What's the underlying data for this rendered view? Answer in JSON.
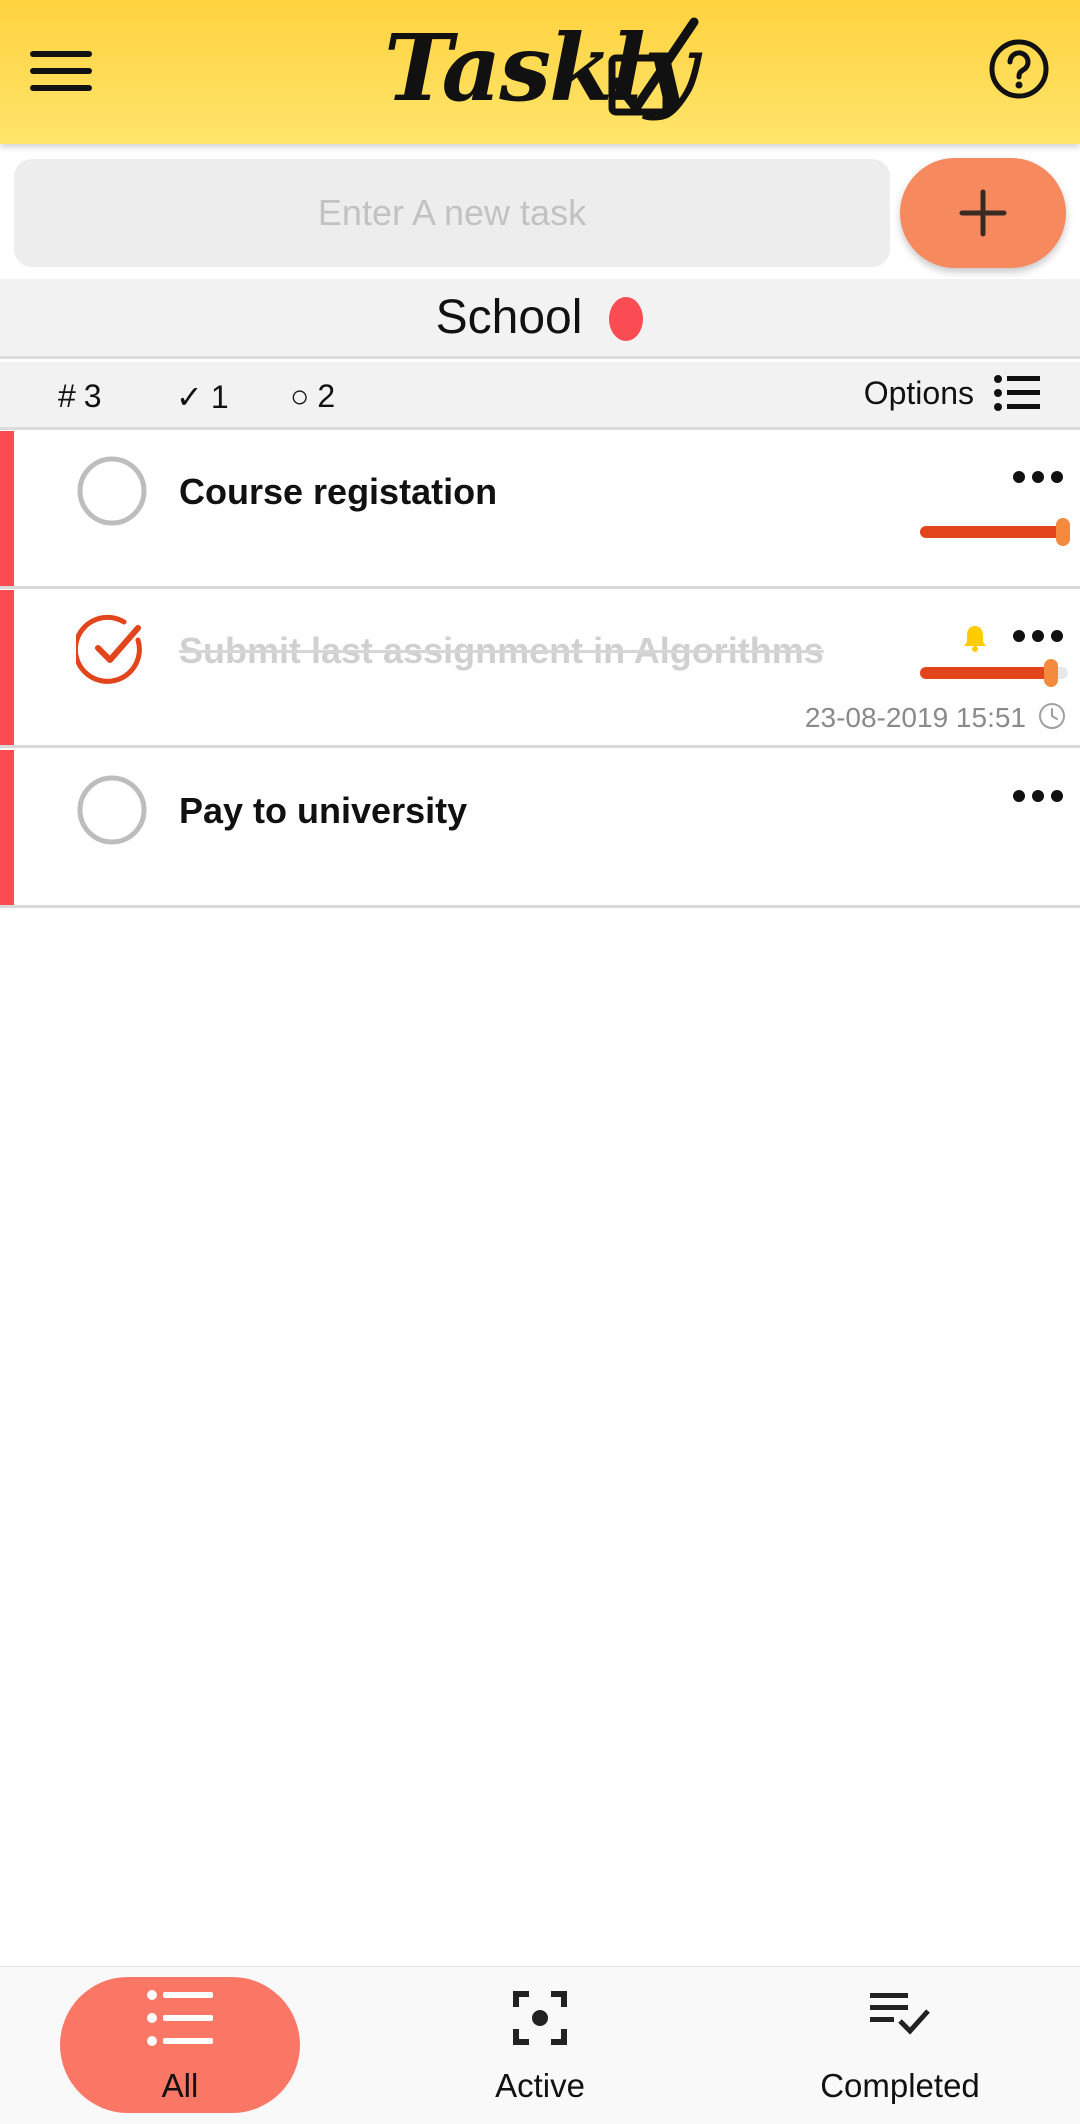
{
  "header": {
    "app_name": "Taskly",
    "menu_icon": "hamburger-menu-icon",
    "help_icon": "help-circle-icon",
    "background": "#ffd23f"
  },
  "new_task": {
    "placeholder": "Enter A new task",
    "add_icon": "plus-icon",
    "add_button_color": "#f7895f"
  },
  "category": {
    "name": "School",
    "color": "#fb4c53"
  },
  "stats": {
    "total_symbol": "#",
    "total": "3",
    "completed_symbol": "✓",
    "completed": "1",
    "active_symbol": "○",
    "active": "2",
    "options_label": "Options",
    "options_icon": "list-icon"
  },
  "tasks": [
    {
      "title": "Course registation",
      "completed": false,
      "priority_fraction": 1.0,
      "has_reminder": false,
      "date": ""
    },
    {
      "title": "Submit last assignment in Algorithms",
      "completed": true,
      "priority_fraction": 0.88,
      "has_reminder": true,
      "date": "23-08-2019 15:51"
    },
    {
      "title": "Pay to university",
      "completed": false,
      "priority_fraction": 0,
      "has_reminder": false,
      "date": ""
    }
  ],
  "colors": {
    "accent": "#e2441c",
    "slider_thumb": "#f5893e",
    "reminder": "#ffcc00",
    "stripe": "#fb4c53"
  },
  "bottom_nav": {
    "items": [
      {
        "label": "All",
        "icon": "list-icon",
        "selected": true
      },
      {
        "label": "Active",
        "icon": "focus-icon",
        "selected": false
      },
      {
        "label": "Completed",
        "icon": "playlist-check-icon",
        "selected": false
      }
    ],
    "selected_color": "#fa7766"
  }
}
